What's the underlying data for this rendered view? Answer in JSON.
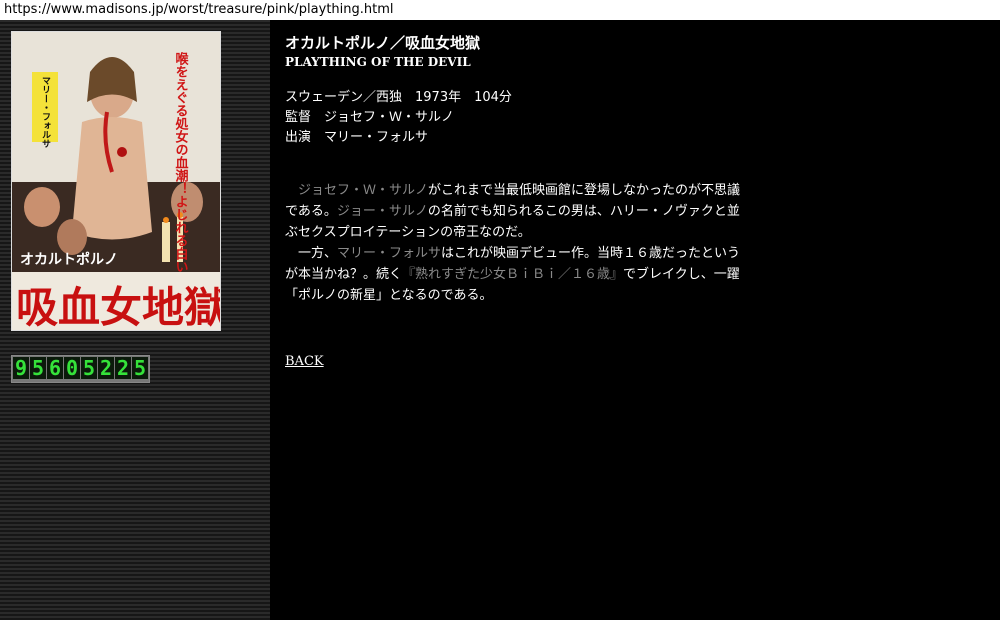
{
  "browser": {
    "url": "https://www.madisons.jp/worst/treasure/pink/plaything.html"
  },
  "sidebar": {
    "poster": {
      "title_text": "吸血女地獄",
      "subtitle_text": "オカルトポルノ",
      "tagline": "喉をえぐる処女の血潮！よじれる白い肉体！",
      "actress_tag": "マリー・フォルサ"
    },
    "counter": {
      "digits": [
        "9",
        "5",
        "6",
        "0",
        "5",
        "2",
        "2",
        "5"
      ]
    }
  },
  "main": {
    "title_jp": "オカルトポルノ／吸血女地獄",
    "title_en": "PLAYTHING OF THE DEVIL",
    "info": {
      "line1": "スウェーデン／西独　1973年　104分",
      "line2": "監督　ジョセフ・Ｗ・サルノ",
      "line3": "出演　マリー・フォルサ"
    },
    "description": {
      "p1_indent": "　",
      "p1_link1": "ジョセフ・Ｗ・サルノ",
      "p1_text1": "がこれまで当最低映画館に登場しなかったのが不思議である。",
      "p1_link2": "ジョー・サルノ",
      "p1_text2": "の名前でも知られるこの男は、ハリー・ノヴァクと並ぶセクスプロイテーションの帝王なのだ。",
      "p2_indent": "　",
      "p2_text0": "一方、",
      "p2_link1": "マリー・フォルサ",
      "p2_text1": "はこれが映画デビュー作。当時１６歳だったというが本当かね？。続く",
      "p2_link2": "『熟れすぎた少女ＢｉＢｉ／１６歳』",
      "p2_text2": "でブレイクし、一躍「ポルノの新星」となるのである。"
    },
    "back_label": "BACK"
  }
}
